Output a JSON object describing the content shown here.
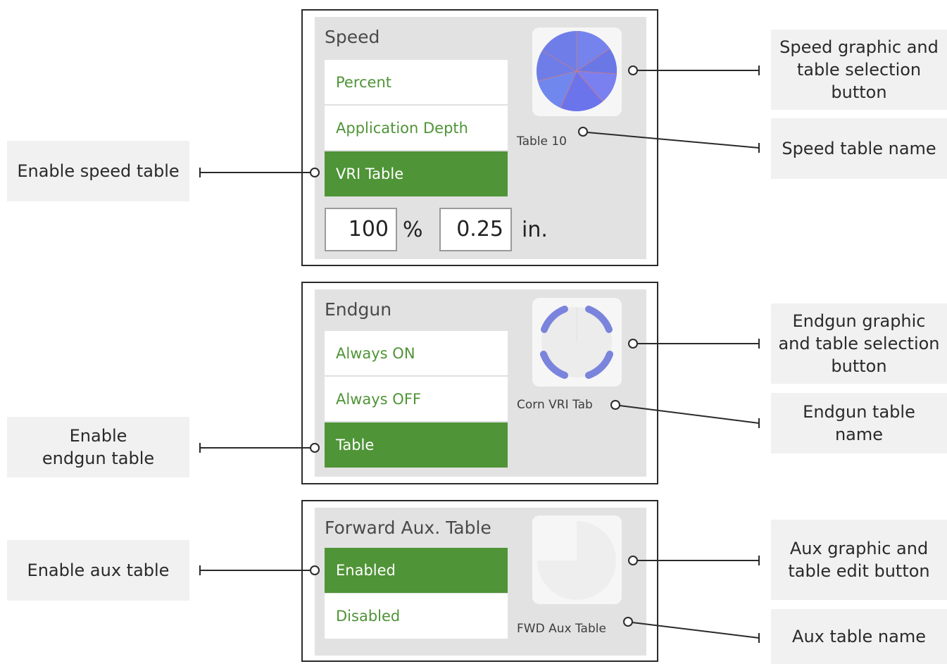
{
  "speed": {
    "title": "Speed",
    "options": [
      "Percent",
      "Application Depth",
      "VRI Table"
    ],
    "selected": "VRI Table",
    "table_name": "Table 10",
    "percent_value": "100",
    "percent_unit": "%",
    "depth_value": "0.25",
    "depth_unit": "in."
  },
  "endgun": {
    "title": "Endgun",
    "options": [
      "Always ON",
      "Always OFF",
      "Table"
    ],
    "selected": "Table",
    "table_name": "Corn VRI Tab"
  },
  "aux": {
    "title": "Forward Aux. Table",
    "options": [
      "Enabled",
      "Disabled"
    ],
    "selected": "Enabled",
    "table_name": "FWD Aux Table"
  },
  "callouts": {
    "enable_speed_table": "Enable speed table",
    "enable_endgun_table": "Enable endgun table",
    "enable_aux_table": "Enable aux table",
    "speed_graphic": "Speed graphic and table selection button",
    "speed_table_name": "Speed table name",
    "endgun_graphic": "Endgun graphic and table selection button",
    "endgun_table_name": "Endgun table name",
    "aux_graphic": "Aux graphic and table edit button",
    "aux_table_name": "Aux table name"
  },
  "colors": {
    "accent_green": "#4f9437",
    "panel_gray": "#e2e2e2",
    "speed_pie_fill": "#6f7de8",
    "endgun_ring": "#7b84dc"
  }
}
